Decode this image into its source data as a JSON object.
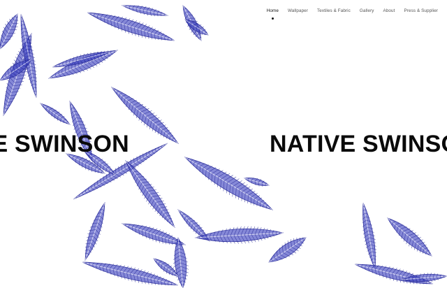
{
  "nav": {
    "items": [
      {
        "label": "Home",
        "active": true
      },
      {
        "label": "Wallpaper"
      },
      {
        "label": "Textiles & Fabric"
      },
      {
        "label": "Gallery"
      },
      {
        "label": "About"
      },
      {
        "label": "Press & Supplier"
      }
    ]
  },
  "hero": {
    "marquee_text": "NATIVE SWINSON"
  },
  "illustration": {
    "subject": "botanical-leaf-sketches",
    "ink_color": "#3a3fbf",
    "shadow_color": "#2a2d9a"
  }
}
